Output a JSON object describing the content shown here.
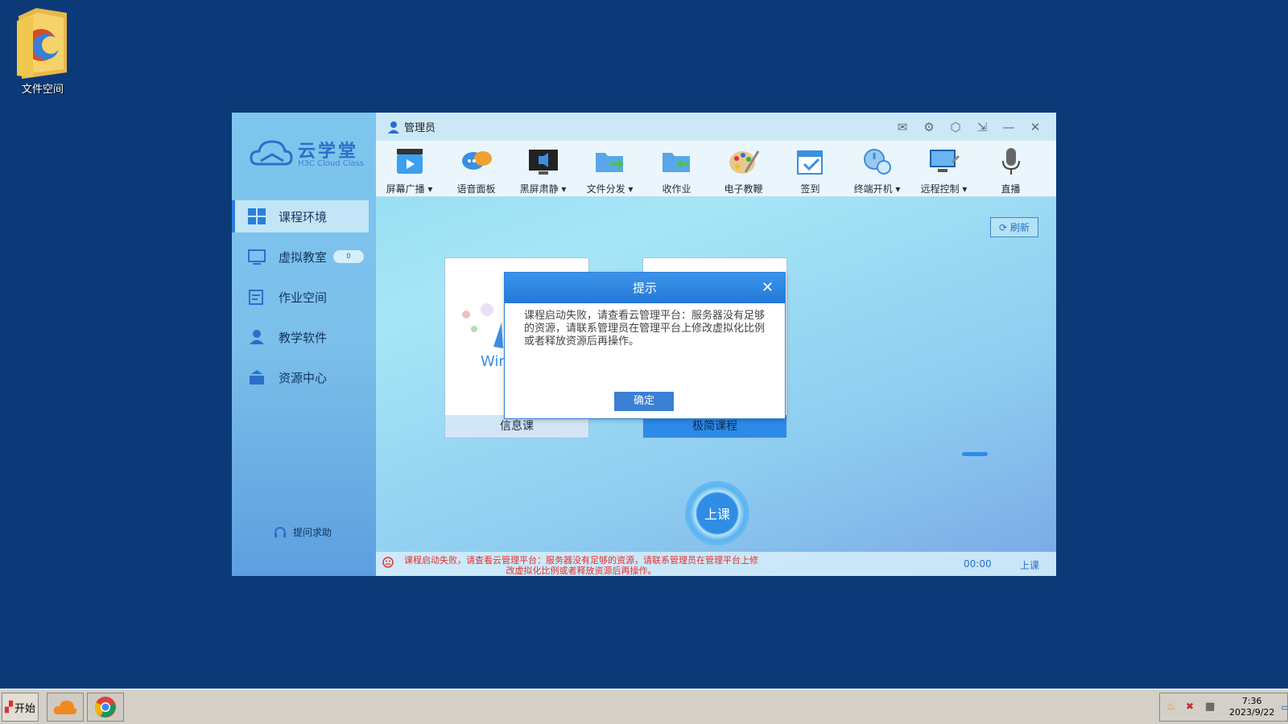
{
  "desktop": {
    "icon_label": "文件空间"
  },
  "app": {
    "logo_cn": "云学堂",
    "logo_en": "H3C Cloud Class",
    "user": "管理员",
    "nav": [
      {
        "label": "课程环境",
        "icon": "windows-icon",
        "active": true
      },
      {
        "label": "虚拟教室",
        "icon": "classroom-icon",
        "badge": "0"
      },
      {
        "label": "作业空间",
        "icon": "homework-icon"
      },
      {
        "label": "教学软件",
        "icon": "software-icon"
      },
      {
        "label": "资源中心",
        "icon": "resource-icon"
      }
    ],
    "help": "提问求助",
    "toolbar": [
      {
        "label": "屏幕广播",
        "dropdown": true
      },
      {
        "label": "语音面板",
        "dropdown": false
      },
      {
        "label": "黑屏肃静",
        "dropdown": true
      },
      {
        "label": "文件分发",
        "dropdown": true
      },
      {
        "label": "收作业",
        "dropdown": false
      },
      {
        "label": "电子教鞭",
        "dropdown": false
      },
      {
        "label": "签到",
        "dropdown": false
      },
      {
        "label": "终端开机",
        "dropdown": true
      },
      {
        "label": "远程控制",
        "dropdown": true
      },
      {
        "label": "直播",
        "dropdown": false
      }
    ],
    "refresh": "刷新",
    "cards": [
      {
        "name": "信息课",
        "preview_text": "Win"
      },
      {
        "name": "极简课程"
      }
    ],
    "start_class": "上课",
    "status": {
      "error": "课程启动失败，请查看云管理平台：服务器没有足够的资源，请联系管理员在管理平台上修改虚拟化比例或者释放资源后再操作。",
      "timer": "00:00",
      "class_type": "上课"
    }
  },
  "dialog": {
    "title": "提示",
    "message": "课程启动失败，请查看云管理平台：服务器没有足够的资源，请联系管理员在管理平台上修改虚拟化比例或者释放资源后再操作。",
    "ok": "确定"
  },
  "taskbar": {
    "start": "开始",
    "time": "7:36",
    "date": "2023/9/22"
  },
  "colors": {
    "desktop": "#0c3a78",
    "accent": "#2d8ae8",
    "error": "#e53030"
  }
}
